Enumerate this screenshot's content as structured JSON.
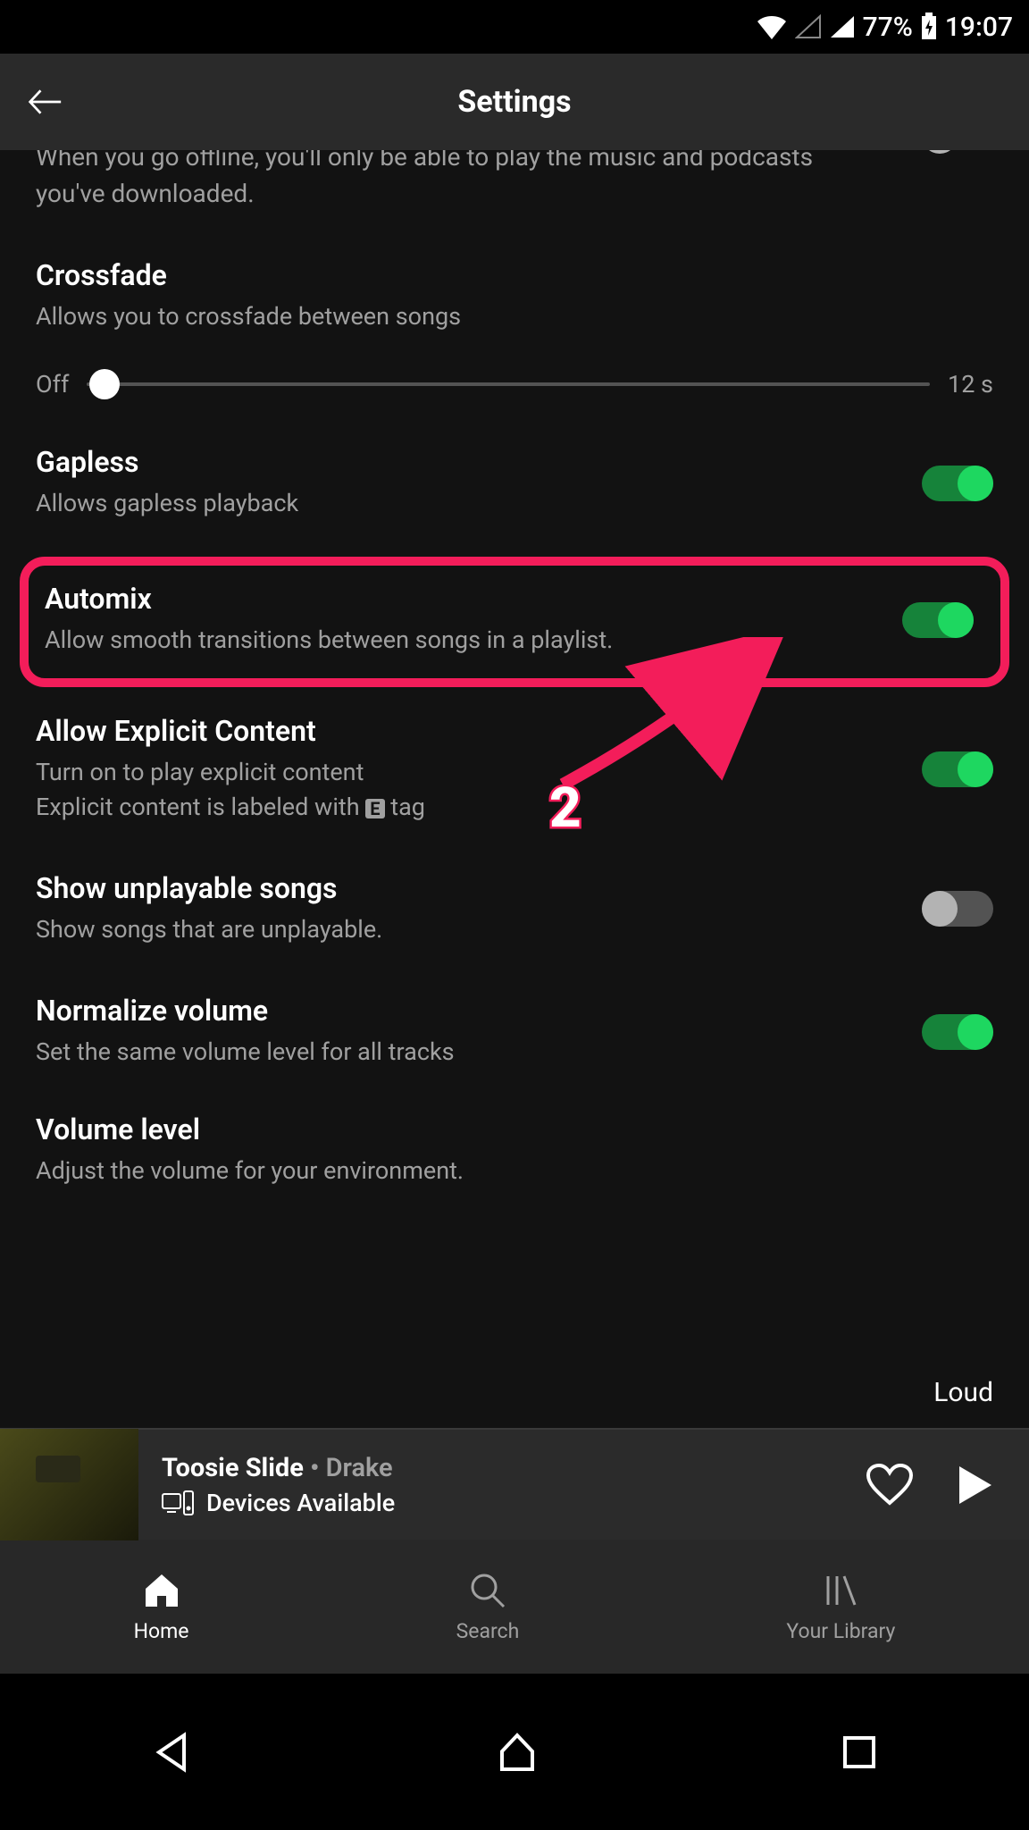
{
  "status_bar": {
    "battery_pct": "77%",
    "time": "19:07"
  },
  "header": {
    "title": "Settings"
  },
  "partial_setting_desc": "When you go offline, you'll only be able to play the music and podcasts you've downloaded.",
  "crossfade": {
    "title": "Crossfade",
    "desc": "Allows you to crossfade between songs",
    "min_label": "Off",
    "max_label": "12 s"
  },
  "gapless": {
    "title": "Gapless",
    "desc": "Allows gapless playback"
  },
  "automix": {
    "title": "Automix",
    "desc": "Allow smooth transitions between songs in a playlist."
  },
  "explicit": {
    "title": "Allow Explicit Content",
    "desc1": "Turn on to play explicit content",
    "desc2_pre": "Explicit content is labeled with ",
    "desc2_tag": "E",
    "desc2_post": " tag"
  },
  "unplayable": {
    "title": "Show unplayable songs",
    "desc": "Show songs that are unplayable."
  },
  "normalize": {
    "title": "Normalize volume",
    "desc": "Set the same volume level for all tracks"
  },
  "volume_level": {
    "title": "Volume level",
    "desc": "Adjust the volume for your environment.",
    "value": "Loud"
  },
  "annotation": {
    "number": "2"
  },
  "now_playing": {
    "track": "Toosie Slide",
    "separator": " • ",
    "artist": "Drake",
    "devices": "Devices Available"
  },
  "tabs": {
    "home": "Home",
    "search": "Search",
    "library": "Your Library"
  }
}
